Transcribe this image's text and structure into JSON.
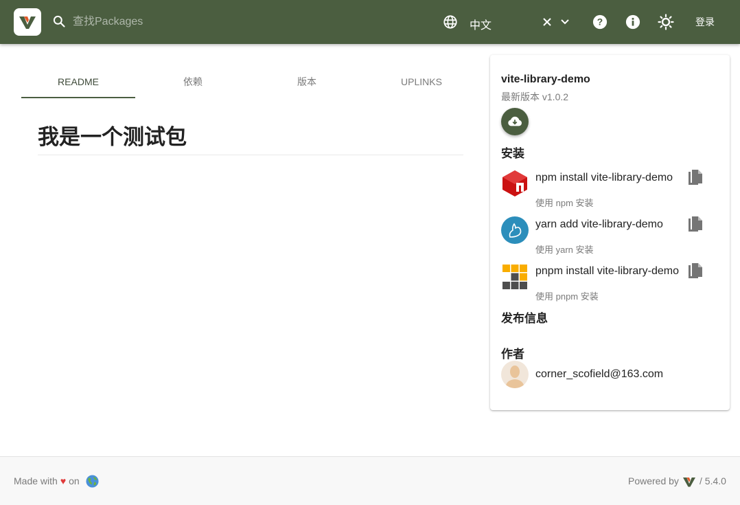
{
  "header": {
    "search_placeholder": "查找Packages",
    "language": "中文",
    "login_label": "登录"
  },
  "tabs": [
    {
      "label": "README",
      "active": true
    },
    {
      "label": "依赖",
      "active": false
    },
    {
      "label": "版本",
      "active": false
    },
    {
      "label": "UPLINKS",
      "active": false
    }
  ],
  "readme": {
    "title": "我是一个测试包"
  },
  "sidebar": {
    "package_name": "vite-library-demo",
    "latest_version": "最新版本 v1.0.2",
    "install_title": "安装",
    "installers": [
      {
        "command": "npm install vite-library-demo",
        "subtitle": "使用 npm 安装",
        "icon": "npm-logo-icon"
      },
      {
        "command": "yarn add vite-library-demo",
        "subtitle": "使用 yarn 安装",
        "icon": "yarn-logo-icon"
      },
      {
        "command": "pnpm install vite-library-demo",
        "subtitle": "使用 pnpm 安装",
        "icon": "pnpm-logo-icon"
      }
    ],
    "publish_info_title": "发布信息",
    "author_title": "作者",
    "author_email": "corner_scofield@163.com"
  },
  "footer": {
    "made_with": "Made with",
    "heart": "♥",
    "on": "on",
    "powered_by": "Powered by",
    "version": "/ 5.4.0"
  },
  "colors": {
    "header_bg": "#4b5e40",
    "accent": "#4b5e40",
    "heart": "#e03a3a"
  }
}
